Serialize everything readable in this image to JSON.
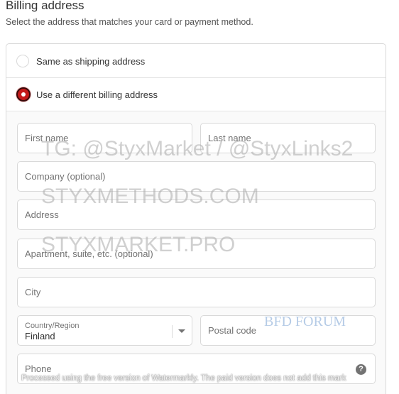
{
  "section": {
    "title": "Billing address",
    "subtitle": "Select the address that matches your card or payment method."
  },
  "options": [
    {
      "label": "Same as shipping address",
      "selected": false
    },
    {
      "label": "Use a different billing address",
      "selected": true
    }
  ],
  "form": {
    "first_name": {
      "placeholder": "First name",
      "value": ""
    },
    "last_name": {
      "placeholder": "Last name",
      "value": ""
    },
    "company": {
      "placeholder": "Company (optional)",
      "value": ""
    },
    "address": {
      "placeholder": "Address",
      "value": ""
    },
    "apartment": {
      "placeholder": "Apartment, suite, etc. (optional)",
      "value": ""
    },
    "city": {
      "placeholder": "City",
      "value": ""
    },
    "country": {
      "label": "Country/Region",
      "value": "Finland"
    },
    "postal_code": {
      "placeholder": "Postal code",
      "value": ""
    },
    "phone": {
      "placeholder": "Phone",
      "value": "",
      "help_icon": "help-icon"
    }
  },
  "watermarks": {
    "line1": "TG: @StyxMarket / @StyxLinks2",
    "line2": "STYXMETHODS.COM",
    "line3": "STYXMARKET.PRO",
    "forum": "BFD FORUM",
    "notice": "Processed using the free version of Watermarkly. The paid version does not add this mark"
  },
  "colors": {
    "accent_radio": "#c41a1a",
    "border": "#d9d9d9",
    "text": "#333333",
    "muted": "#737373"
  }
}
